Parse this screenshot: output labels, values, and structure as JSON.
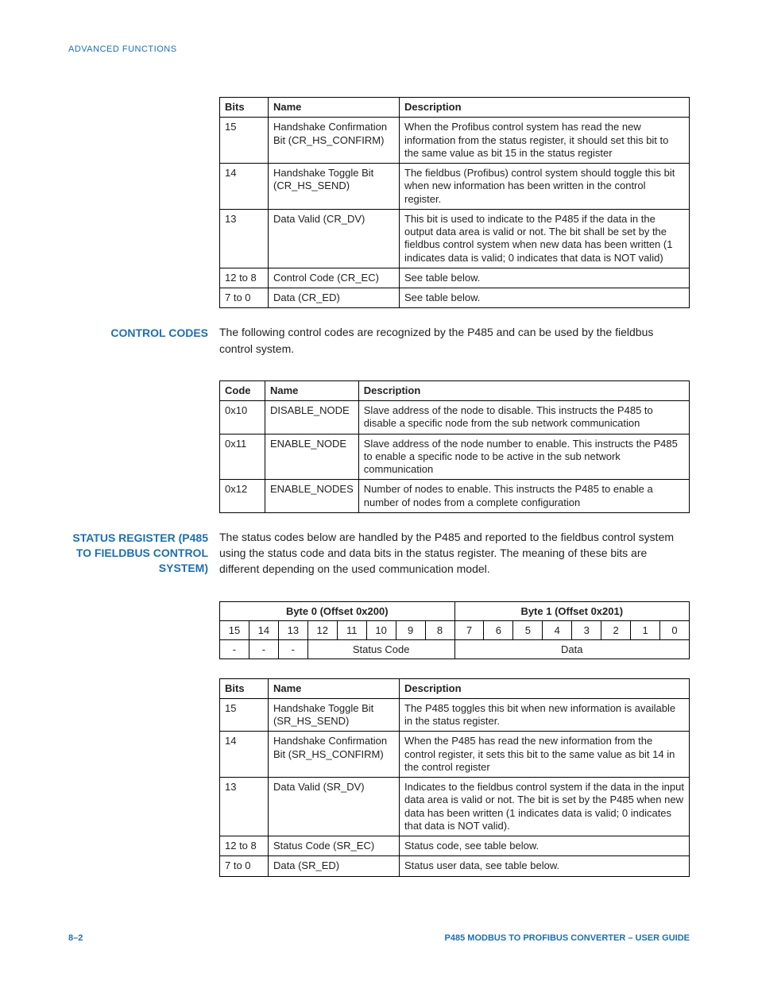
{
  "header": "ADVANCED FUNCTIONS",
  "footer": {
    "left": "8–2",
    "right": "P485 MODBUS TO PROFIBUS CONVERTER – USER GUIDE"
  },
  "table1": {
    "headers": [
      "Bits",
      "Name",
      "Description"
    ],
    "rows": [
      [
        "15",
        "Handshake Confirmation Bit (CR_HS_CONFIRM)",
        "When the Profibus control system has read the new information from the status register, it should set this bit to the same value as bit 15 in the status register"
      ],
      [
        "14",
        "Handshake Toggle Bit (CR_HS_SEND)",
        "The fieldbus (Profibus) control system should toggle this bit when new information has been written in the control register."
      ],
      [
        "13",
        "Data Valid (CR_DV)",
        "This bit is used to indicate to the P485 if the data in the output data area is valid or not. The bit shall be set by the fieldbus control system when new data has been written (1 indicates data is valid; 0 indicates that data is NOT valid)"
      ],
      [
        "12 to 8",
        "Control Code (CR_EC)",
        "See table below."
      ],
      [
        "7 to 0",
        "Data (CR_ED)",
        "See table below."
      ]
    ]
  },
  "section2": {
    "heading": "CONTROL CODES",
    "intro": "The following control codes are recognized by the P485 and can be used by the fieldbus control system."
  },
  "table2": {
    "headers": [
      "Code",
      "Name",
      "Description"
    ],
    "rows": [
      [
        "0x10",
        "DISABLE_NODE",
        "Slave address of the node to disable. This instructs the P485 to disable a specific node from the sub network communication"
      ],
      [
        "0x11",
        "ENABLE_NODE",
        "Slave address of the node number to enable. This instructs the P485 to enable a specific node to be active in the sub network communication"
      ],
      [
        "0x12",
        "ENABLE_NODES",
        "Number of nodes to enable. This instructs the P485 to enable a number of nodes from a complete configuration"
      ]
    ]
  },
  "section3": {
    "heading": "STATUS REGISTER (P485 TO FIELDBUS CONTROL SYSTEM)",
    "intro": "The status codes below are handled by the P485 and reported to the fieldbus control system using the status code and data bits in the status register. The meaning of these bits are different depending on the used communication model."
  },
  "bitmap": {
    "byte0_label": "Byte 0 (Offset 0x200)",
    "byte1_label": "Byte 1 (Offset 0x201)",
    "bits": [
      "15",
      "14",
      "13",
      "12",
      "11",
      "10",
      "9",
      "8",
      "7",
      "6",
      "5",
      "4",
      "3",
      "2",
      "1",
      "0"
    ],
    "row3": {
      "dash": "-",
      "status": "Status Code",
      "data": "Data"
    }
  },
  "table3": {
    "headers": [
      "Bits",
      "Name",
      "Description"
    ],
    "rows": [
      [
        "15",
        "Handshake Toggle Bit (SR_HS_SEND)",
        "The P485 toggles this bit when new information is available in the status register."
      ],
      [
        "14",
        "Handshake Confirmation Bit (SR_HS_CONFIRM)",
        "When the P485 has read the new information from the control register, it sets this bit to the same value as bit 14 in the control register"
      ],
      [
        "13",
        "Data Valid (SR_DV)",
        "Indicates to the fieldbus control system if the data in the input data area is valid or not. The bit is set by the P485 when new data has been written (1 indicates data is valid; 0 indicates that data is NOT valid)."
      ],
      [
        "12 to 8",
        "Status Code (SR_EC)",
        "Status code, see table below."
      ],
      [
        "7 to 0",
        "Data (SR_ED)",
        "Status user data, see table below."
      ]
    ]
  }
}
